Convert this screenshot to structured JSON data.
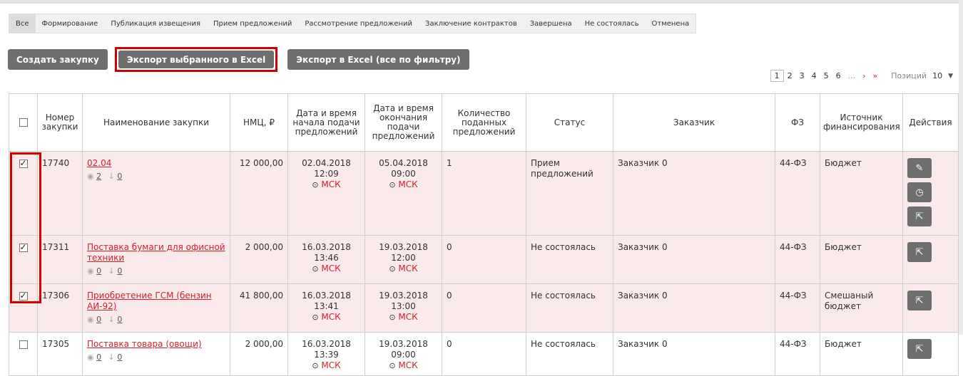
{
  "tabs": [
    {
      "label": "Все",
      "active": true
    },
    {
      "label": "Формирование"
    },
    {
      "label": "Публикация извещения"
    },
    {
      "label": "Прием предложений"
    },
    {
      "label": "Рассмотрение предложений"
    },
    {
      "label": "Заключение контрактов"
    },
    {
      "label": "Завершена"
    },
    {
      "label": "Не состоялась"
    },
    {
      "label": "Отменена"
    }
  ],
  "buttons": {
    "create": "Создать закупку",
    "export_selected": "Экспорт выбранного в Excel",
    "export_all": "Экспорт в Excel (все по фильтру)"
  },
  "pager": {
    "pages": [
      "1",
      "2",
      "3",
      "4",
      "5",
      "6"
    ],
    "ellipsis": "...",
    "next": "›",
    "last": "»",
    "positions_label": "Позиций",
    "positions_value": "10"
  },
  "table": {
    "headers": {
      "number": "Номер закупки",
      "name": "Наименование закупки",
      "nmc": "НМЦ, ₽",
      "start": "Дата и время начала подачи предложений",
      "end": "Дата и время окончания подачи предложений",
      "count": "Количество поданных предложений",
      "status": "Статус",
      "customer": "Заказчик",
      "fz": "ФЗ",
      "source": "Источник финансирования",
      "actions": "Действия"
    },
    "rows": [
      {
        "checked": true,
        "number": "17740",
        "name": "02.04",
        "views": "2",
        "downloads": "0",
        "nmc": "12 000,00",
        "start": "02.04.2018 12:09",
        "end": "05.04.2018 09:00",
        "tz": "МСК",
        "count": "1",
        "status": "Прием предложений",
        "customer": "Заказчик 0",
        "fz": "44-ФЗ",
        "source": "Бюджет"
      },
      {
        "checked": true,
        "number": "17311",
        "name": "Поставка бумаги для офисной техники",
        "views": "0",
        "downloads": "0",
        "nmc": "2 000,00",
        "start": "16.03.2018 13:46",
        "end": "19.03.2018 12:00",
        "tz": "МСК",
        "count": "0",
        "status": "Не состоялась",
        "customer": "Заказчик 0",
        "fz": "44-ФЗ",
        "source": "Бюджет"
      },
      {
        "checked": true,
        "number": "17306",
        "name": "Приобретение ГСМ (бензин АИ-92)",
        "views": "0",
        "downloads": "0",
        "nmc": "41 800,00",
        "start": "16.03.2018 13:41",
        "end": "19.03.2018 13:00",
        "tz": "МСК",
        "count": "0",
        "status": "Не состоялась",
        "customer": "Заказчик 0",
        "fz": "44-ФЗ",
        "source": "Смешаный бюджет"
      },
      {
        "checked": false,
        "number": "17305",
        "name": "Поставка товара (овощи)",
        "views": "0",
        "downloads": "0",
        "nmc": "2 000,00",
        "start": "16.03.2018 13:39",
        "end": "19.03.2018 09:00",
        "tz": "МСК",
        "count": "0",
        "status": "Не состоялась",
        "customer": "Заказчик 0",
        "fz": "44-ФЗ",
        "source": "Бюджет"
      }
    ]
  },
  "icons": {
    "edit": "pencil-icon",
    "history": "clock-icon",
    "export": "export-icon",
    "view": "eye-icon",
    "download": "download-icon"
  },
  "colors": {
    "accent_red": "#d61f2b",
    "button_gray": "#6e6e6e",
    "selected_row": "#fbeaec",
    "highlight_frame": "#d10000"
  }
}
